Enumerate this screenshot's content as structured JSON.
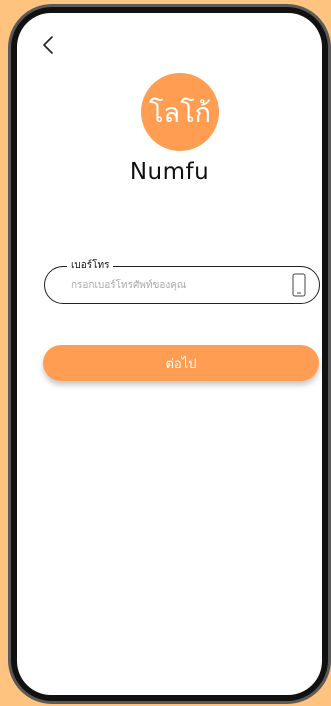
{
  "app": {
    "logo_text": "โลโก้",
    "name": "Numfu"
  },
  "form": {
    "phone_label": "เบอร์โทร",
    "phone_placeholder": "กรอกเบอร์โทรศัพท์ของคุณ",
    "phone_value": "",
    "next_label": "ต่อไป"
  },
  "icons": {
    "back": "chevron-left-icon",
    "phone": "smartphone-icon"
  },
  "colors": {
    "background": "#FDC37F",
    "accent": "#FF9E52",
    "frame": "#111111",
    "screen": "#FFFFFF"
  }
}
